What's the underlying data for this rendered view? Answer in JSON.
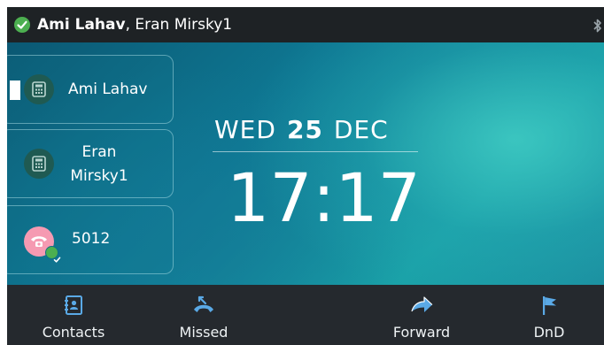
{
  "status_bar": {
    "primary_account": "Ami Lahav",
    "separator": ",",
    "secondary_account": "Eran Mirsky1",
    "registered_icon": "check-circle-icon",
    "bluetooth_icon": "bluetooth-icon"
  },
  "line_keys": [
    {
      "label": "Ami Lahav",
      "icon": "desk-phone-icon",
      "selected": true
    },
    {
      "label": "Eran Mirsky1",
      "icon": "desk-phone-icon",
      "selected": false
    },
    {
      "label": "5012",
      "icon": "handset-icon",
      "status": "available"
    }
  ],
  "clock": {
    "weekday": "WED",
    "day": "25",
    "month": "DEC",
    "time": "17:17"
  },
  "softkeys": [
    {
      "label": "Contacts",
      "icon": "contacts-icon"
    },
    {
      "label": "Missed",
      "icon": "missed-call-icon"
    },
    {
      "label": "",
      "icon": ""
    },
    {
      "label": "Forward",
      "icon": "forward-arrow-icon"
    },
    {
      "label": "DnD",
      "icon": "flag-icon"
    }
  ],
  "colors": {
    "status_bar_bg": "#1e2225",
    "softkey_bar_bg": "#25292e",
    "accent_green": "#4caf50",
    "icon_blue": "#5aa9e6",
    "screen_teal": "#0e7893"
  }
}
